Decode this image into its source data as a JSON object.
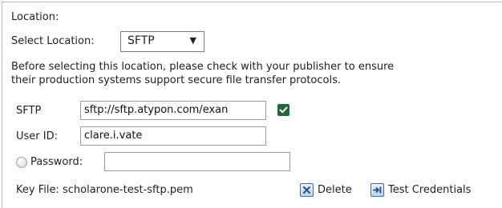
{
  "heading": "Location:",
  "select_location": {
    "label": "Select Location:",
    "value": "SFTP",
    "caret": "▼"
  },
  "notice": {
    "line1": "Before selecting this location, please check with your publisher to ensure",
    "line2": "their production systems support secure file transfer protocols."
  },
  "sftp": {
    "label": "SFTP",
    "value": "sftp://sftp.atypon.com/exan",
    "verified": true
  },
  "user": {
    "label": "User ID:",
    "value": "clare.i.vate"
  },
  "password": {
    "label": "Password:",
    "value": ""
  },
  "keyfile": {
    "label": "Key File: scholarone-test-sftp.pem"
  },
  "actions": {
    "delete": "Delete",
    "test": "Test Credentials"
  },
  "colors": {
    "check": "#1f6b33",
    "button_border": "#3e73a8"
  }
}
